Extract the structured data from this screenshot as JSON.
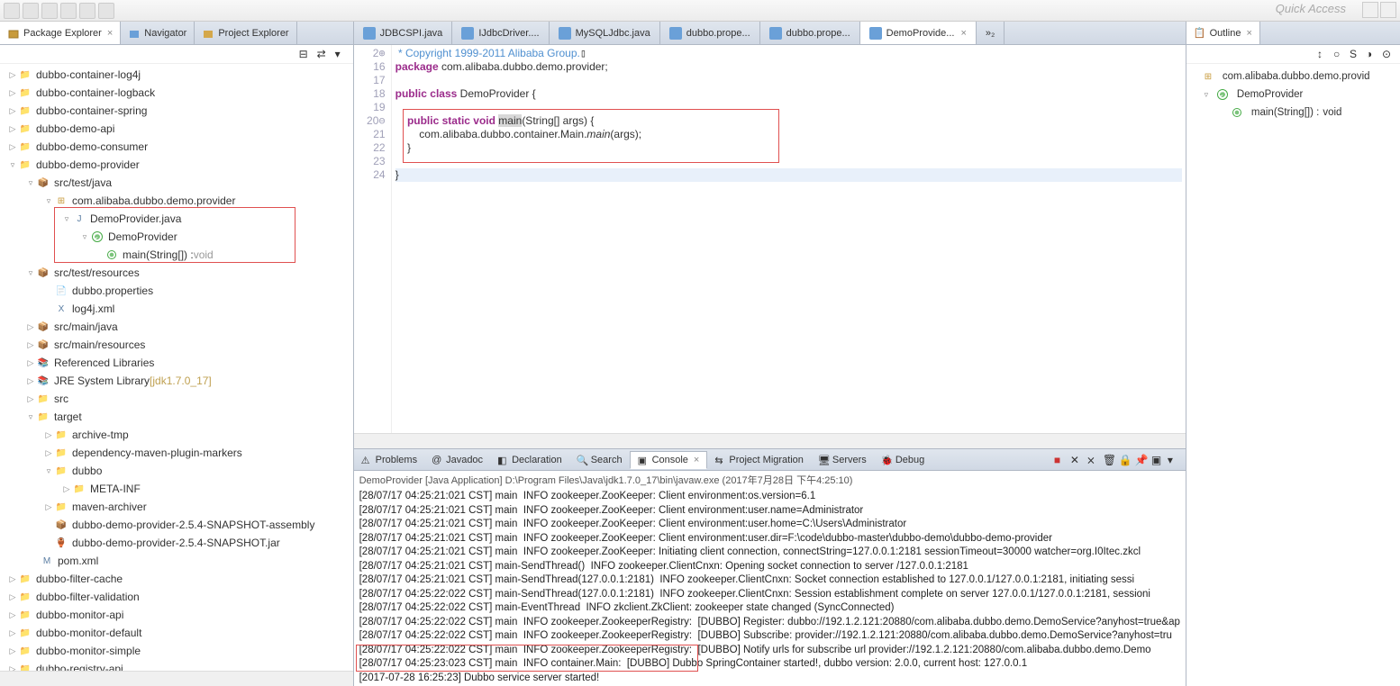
{
  "quick_access": "Quick Access",
  "left_tabs": [
    {
      "label": "Package Explorer",
      "active": true
    },
    {
      "label": "Navigator",
      "active": false
    },
    {
      "label": "Project Explorer",
      "active": false
    }
  ],
  "tree": {
    "n0": "dubbo-container-log4j",
    "n1": "dubbo-container-logback",
    "n2": "dubbo-container-spring",
    "n3": "dubbo-demo-api",
    "n4": "dubbo-demo-consumer",
    "n5": "dubbo-demo-provider",
    "n6": "src/test/java",
    "n7": "com.alibaba.dubbo.demo.provider",
    "n8": "DemoProvider.java",
    "n9": "DemoProvider",
    "n10": "main(String[]) : ",
    "n10_type": "void",
    "n11": "src/test/resources",
    "n12": "dubbo.properties",
    "n13": "log4j.xml",
    "n14": "src/main/java",
    "n15": "src/main/resources",
    "n16": "Referenced Libraries",
    "n17": "JRE System Library ",
    "n17_ver": "[jdk1.7.0_17]",
    "n18": "src",
    "n19": "target",
    "n20": "archive-tmp",
    "n21": "dependency-maven-plugin-markers",
    "n22": "dubbo",
    "n23": "META-INF",
    "n24": "maven-archiver",
    "n25": "dubbo-demo-provider-2.5.4-SNAPSHOT-assembly",
    "n26": "dubbo-demo-provider-2.5.4-SNAPSHOT.jar",
    "n27": "pom.xml",
    "n28": "dubbo-filter-cache",
    "n29": "dubbo-filter-validation",
    "n30": "dubbo-monitor-api",
    "n31": "dubbo-monitor-default",
    "n32": "dubbo-monitor-simple",
    "n33": "dubbo-registry-api"
  },
  "editor_tabs": [
    {
      "label": "JDBCSPI.java",
      "active": false
    },
    {
      "label": "IJdbcDriver....",
      "active": false
    },
    {
      "label": "MySQLJdbc.java",
      "active": false
    },
    {
      "label": "dubbo.prope...",
      "active": false
    },
    {
      "label": "dubbo.prope...",
      "active": false
    },
    {
      "label": "DemoProvide...",
      "active": true
    },
    {
      "label": "»₂",
      "active": false
    }
  ],
  "code": {
    "l2": " * Copyright 1999-2011 Alibaba Group.",
    "l16a": "package",
    "l16b": " com.alibaba.dubbo.demo.provider;",
    "l18a": "public class",
    "l18b": " DemoProvider {",
    "l20a": "    public static void ",
    "l20b": "main",
    "l20c": "(String[] args) {",
    "l21a": "        com.alibaba.dubbo.container.Main.",
    "l21b": "main",
    "l21c": "(args);",
    "l22": "    }",
    "l24": "}"
  },
  "gutter": [
    "2",
    "16",
    "17",
    "18",
    "19",
    "20",
    "21",
    "22",
    "23",
    "24"
  ],
  "bottom_tabs": [
    {
      "label": "Problems"
    },
    {
      "label": "Javadoc"
    },
    {
      "label": "Declaration"
    },
    {
      "label": "Search"
    },
    {
      "label": "Console",
      "active": true
    },
    {
      "label": "Project Migration"
    },
    {
      "label": "Servers"
    },
    {
      "label": "Debug"
    }
  ],
  "console_title": "DemoProvider [Java Application] D:\\Program Files\\Java\\jdk1.7.0_17\\bin\\javaw.exe (2017年7月28日 下午4:25:10)",
  "console_lines": [
    "[28/07/17 04:25:21:021 CST] main  INFO zookeeper.ZooKeeper: Client environment:os.version=6.1",
    "[28/07/17 04:25:21:021 CST] main  INFO zookeeper.ZooKeeper: Client environment:user.name=Administrator",
    "[28/07/17 04:25:21:021 CST] main  INFO zookeeper.ZooKeeper: Client environment:user.home=C:\\Users\\Administrator",
    "[28/07/17 04:25:21:021 CST] main  INFO zookeeper.ZooKeeper: Client environment:user.dir=F:\\code\\dubbo-master\\dubbo-demo\\dubbo-demo-provider",
    "[28/07/17 04:25:21:021 CST] main  INFO zookeeper.ZooKeeper: Initiating client connection, connectString=127.0.0.1:2181 sessionTimeout=30000 watcher=org.I0Itec.zkcl",
    "[28/07/17 04:25:21:021 CST] main-SendThread()  INFO zookeeper.ClientCnxn: Opening socket connection to server /127.0.0.1:2181",
    "[28/07/17 04:25:21:021 CST] main-SendThread(127.0.0.1:2181)  INFO zookeeper.ClientCnxn: Socket connection established to 127.0.0.1/127.0.0.1:2181, initiating sessi",
    "[28/07/17 04:25:22:022 CST] main-SendThread(127.0.0.1:2181)  INFO zookeeper.ClientCnxn: Session establishment complete on server 127.0.0.1/127.0.0.1:2181, sessioni",
    "[28/07/17 04:25:22:022 CST] main-EventThread  INFO zkclient.ZkClient: zookeeper state changed (SyncConnected)",
    "[28/07/17 04:25:22:022 CST] main  INFO zookeeper.ZookeeperRegistry:  [DUBBO] Register: dubbo://192.1.2.121:20880/com.alibaba.dubbo.demo.DemoService?anyhost=true&ap",
    "[28/07/17 04:25:22:022 CST] main  INFO zookeeper.ZookeeperRegistry:  [DUBBO] Subscribe: provider://192.1.2.121:20880/com.alibaba.dubbo.demo.DemoService?anyhost=tru",
    "[28/07/17 04:25:22:022 CST] main  INFO zookeeper.ZookeeperRegistry:  [DUBBO] Notify urls for subscribe url provider://192.1.2.121:20880/com.alibaba.dubbo.demo.Demo",
    "[28/07/17 04:25:23:023 CST] main  INFO container.Main:  [DUBBO] Dubbo SpringContainer started!, dubbo version: 2.0.0, current host: 127.0.0.1",
    "[2017-07-28 16:25:23] Dubbo service server started!"
  ],
  "outline": {
    "tab": "Outline",
    "pkg": "com.alibaba.dubbo.demo.provid",
    "class": "DemoProvider",
    "method": "main(String[]) : ",
    "method_type": "void"
  }
}
